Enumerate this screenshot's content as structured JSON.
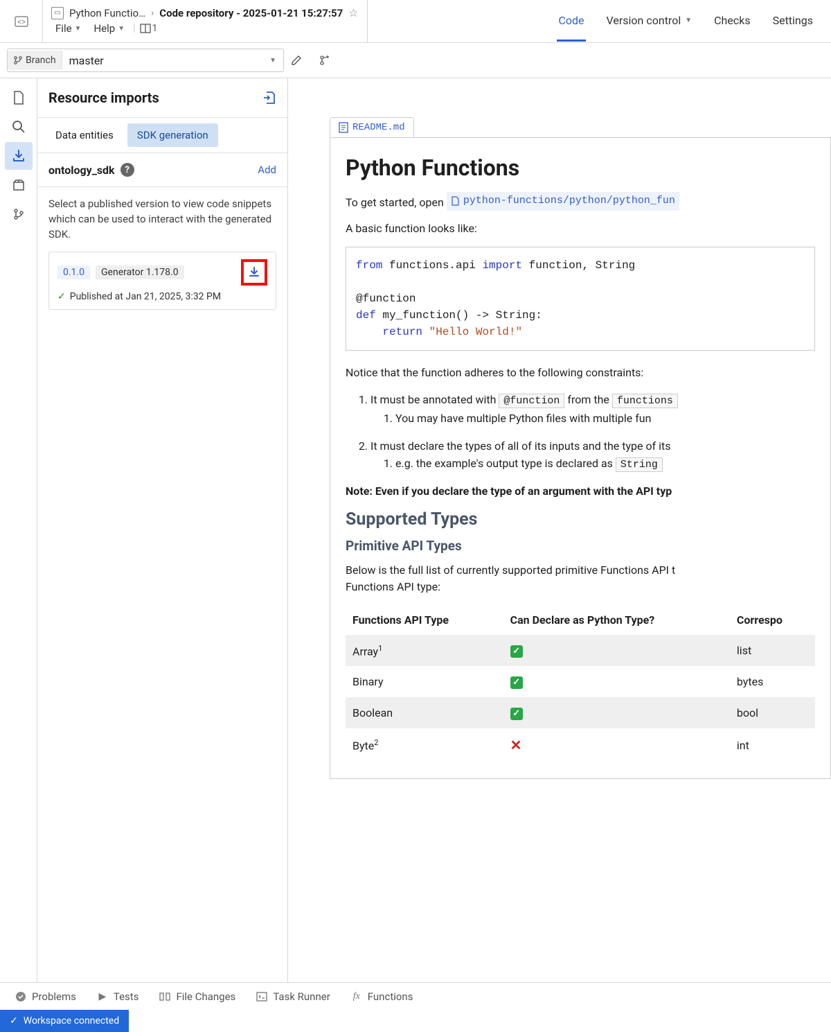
{
  "breadcrumb": {
    "truncated": "Python Functio…",
    "current": "Code repository - 2025-01-21 15:27:57"
  },
  "menu": {
    "file": "File",
    "help": "Help",
    "panes_count": "1"
  },
  "top_tabs": {
    "code": "Code",
    "version_control": "Version control",
    "checks": "Checks",
    "settings": "Settings"
  },
  "branch": {
    "label": "Branch",
    "name": "master"
  },
  "side": {
    "title": "Resource imports",
    "tab_entities": "Data entities",
    "tab_sdk": "SDK generation",
    "sdk_name": "ontology_sdk",
    "add": "Add",
    "desc": "Select a published version to view code snippets which can be used to interact with the generated SDK.",
    "version_badge": "0.1.0",
    "generator_badge": "Generator 1.178.0",
    "published": "Published at Jan 21, 2025, 3:32 PM"
  },
  "readme": {
    "filename": "README.md",
    "h1": "Python Functions",
    "intro_prefix": "To get started, open ",
    "intro_file": "python-functions/python/python_fun",
    "basic_line": "A basic function looks like:",
    "notice": "Notice that the function adheres to the following constraints:",
    "li1_a": "It must be annotated with ",
    "li1_code": "@function",
    "li1_b": " from the ",
    "li1_code2": "functions",
    "li1_1": "You may have multiple Python files with multiple fun",
    "li2": "It must declare the types of all of its inputs and the type of its",
    "li2_1a": "e.g. the example's output type is declared as ",
    "li2_1code": "String",
    "note": "Note: Even if you declare the type of an argument with the API typ",
    "h2": "Supported Types",
    "h3": "Primitive API Types",
    "below": "Below is the full list of currently supported primitive Functions API t",
    "below2": "Functions API type:",
    "th1": "Functions API Type",
    "th2": "Can Declare as Python Type?",
    "th3": "Correspo",
    "rows": [
      {
        "t": "Array",
        "sup": "1",
        "ok": true,
        "py": "list"
      },
      {
        "t": "Binary",
        "sup": "",
        "ok": true,
        "py": "bytes"
      },
      {
        "t": "Boolean",
        "sup": "",
        "ok": true,
        "py": "bool"
      },
      {
        "t": "Byte",
        "sup": "2",
        "ok": false,
        "py": "int"
      }
    ]
  },
  "code": {
    "l1a": "from",
    "l1b": " functions.api ",
    "l1c": "import",
    "l1d": " function, String",
    "l3": "@function",
    "l4a": "def",
    "l4b": " my_function() -> String:",
    "l5a": "    ",
    "l5b": "return",
    "l5c": " ",
    "l5d": "\"Hello World!\""
  },
  "bottom": {
    "problems": "Problems",
    "tests": "Tests",
    "file_changes": "File Changes",
    "task_runner": "Task Runner",
    "functions": "Functions"
  },
  "status": "Workspace connected"
}
